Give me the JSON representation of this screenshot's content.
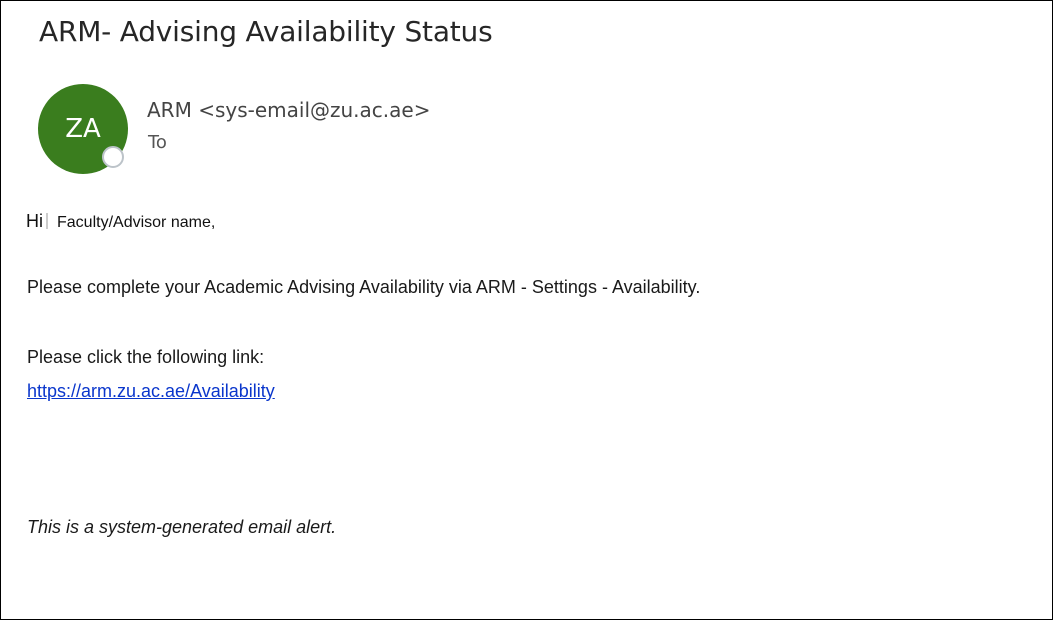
{
  "email": {
    "subject": "ARM- Advising Availability Status",
    "avatar_initials": "ZA",
    "sender": "ARM <sys-email@zu.ac.ae>",
    "to_label": "To",
    "greeting_hi": "Hi",
    "greeting_name": "Faculty/Advisor name,",
    "instruction": "Please complete your Academic Advising Availability via ARM - Settings - Availability.",
    "click_prompt": "Please click the following link:",
    "link": "https://arm.zu.ac.ae/Availability",
    "footer": "This is a system-generated email alert."
  },
  "colors": {
    "avatar_bg": "#3a7d1e",
    "link": "#0a36cc"
  }
}
